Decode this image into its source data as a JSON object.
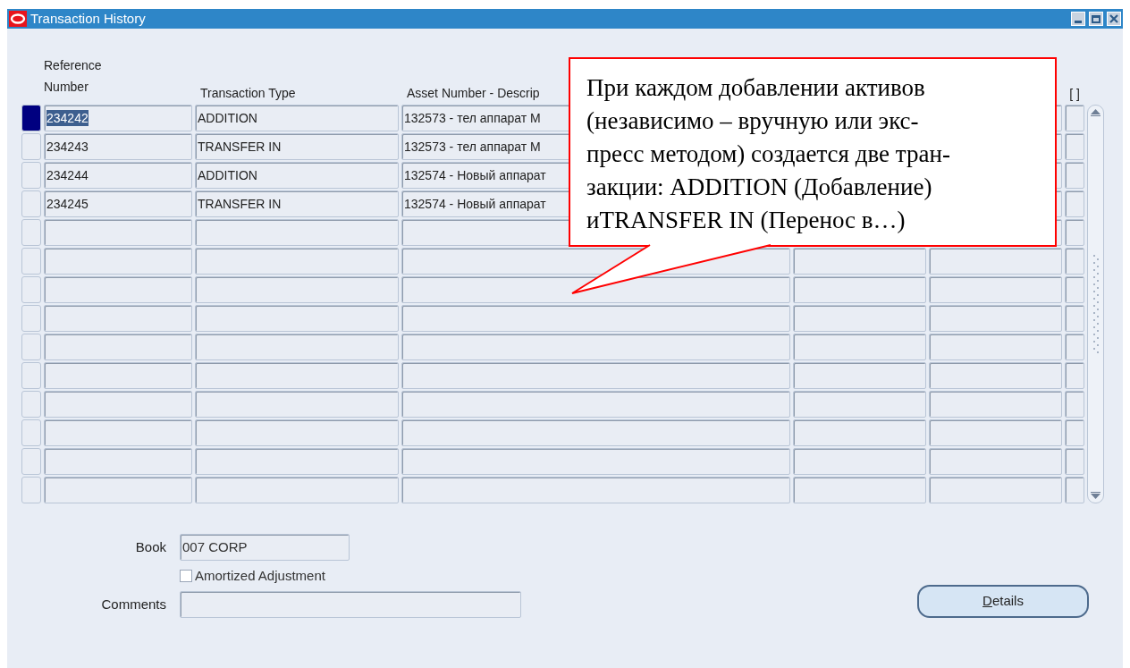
{
  "window": {
    "title": "Transaction History"
  },
  "table": {
    "columns": [
      "Reference Number",
      "Transaction Type",
      "Asset Number - Descrip",
      "[ ]"
    ],
    "rows": [
      {
        "reference": "234242",
        "type": "ADDITION",
        "asset": "132573 - тел аппарат М",
        "selected": true
      },
      {
        "reference": "234243",
        "type": "TRANSFER IN",
        "asset": "132573 - тел аппарат М",
        "selected": false
      },
      {
        "reference": "234244",
        "type": "ADDITION",
        "asset": "132574 - Новый аппарат",
        "selected": false
      },
      {
        "reference": "234245",
        "type": "TRANSFER IN",
        "asset": "132574 - Новый аппарат",
        "selected": false
      }
    ]
  },
  "form": {
    "book_label": "Book",
    "book_value": "007 CORP",
    "checkbox": {
      "label": "Amortized Adjustment",
      "checked": false
    },
    "comments_label": "Comments"
  },
  "buttons": [
    "Details"
  ],
  "callout": {
    "text": "При каждом добавлении активов\n(независимо – вручную или экс-\nпресс методом) создается две тран-\nзакции: ADDITION (Добавление)\nиTRANSFER IN (Перенос в…)"
  }
}
